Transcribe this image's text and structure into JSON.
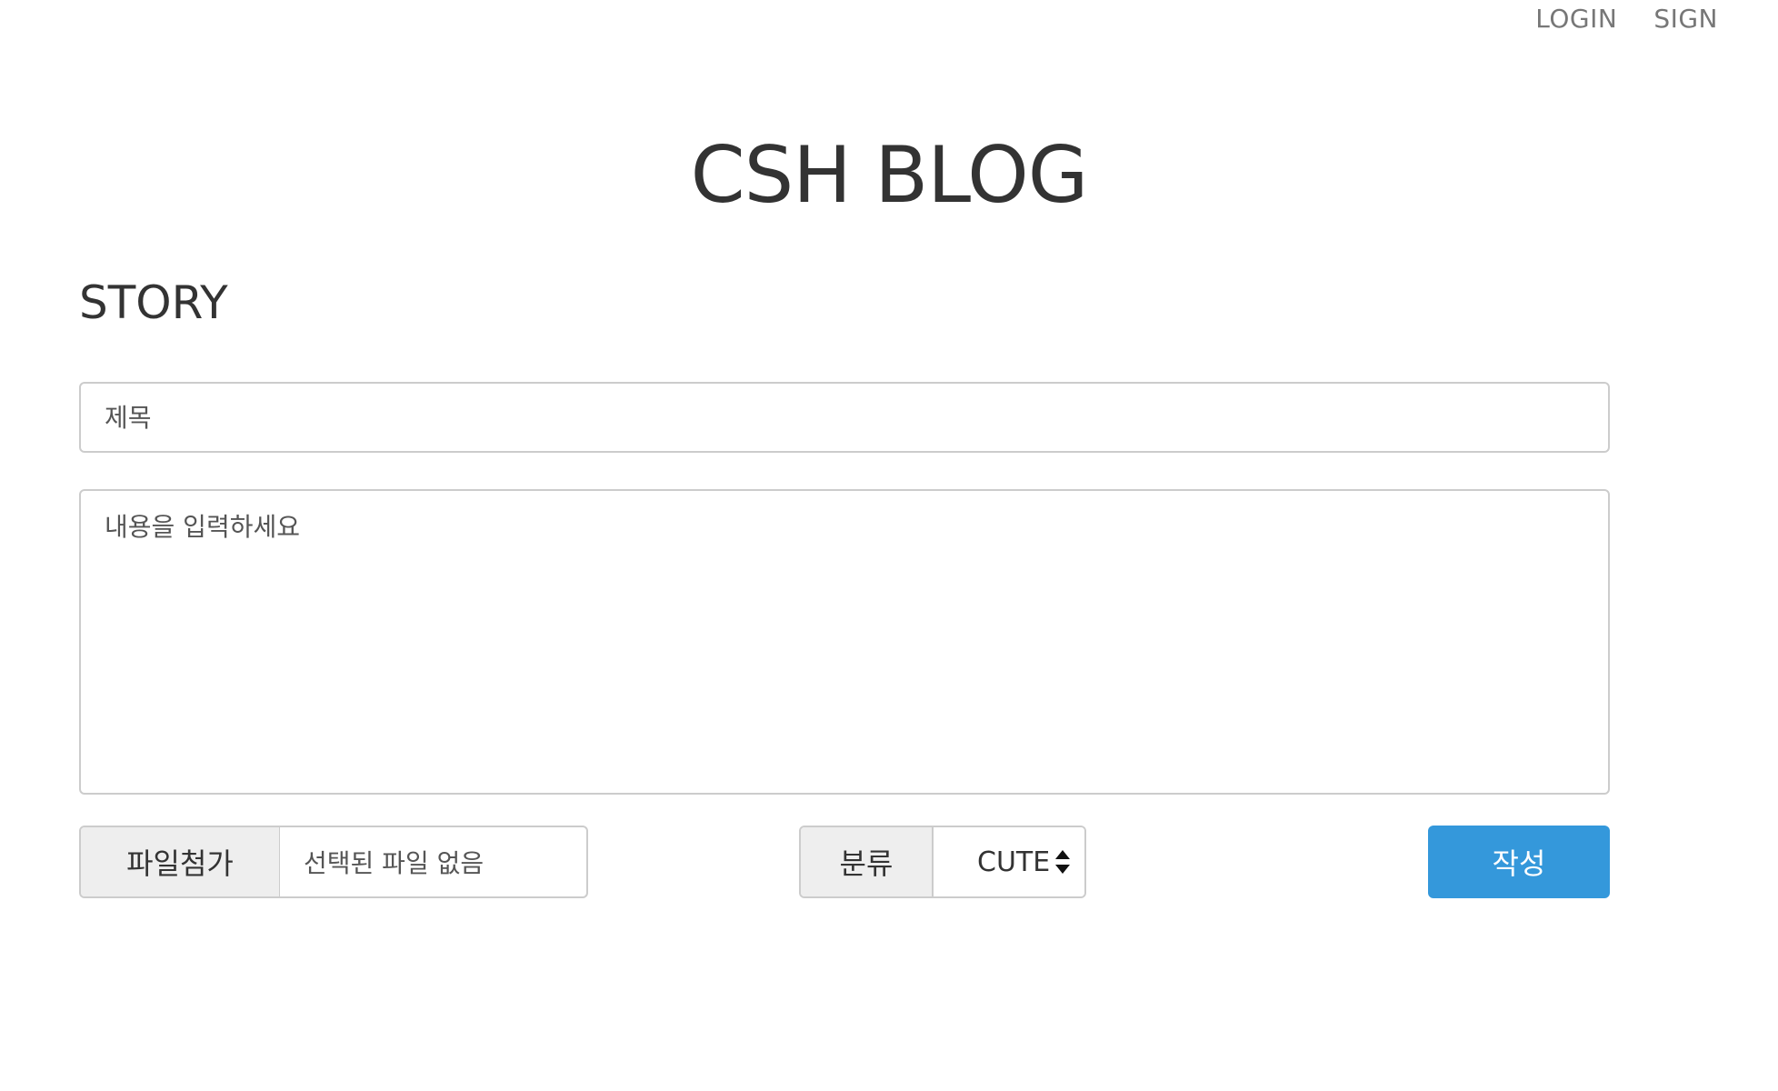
{
  "nav": {
    "login": "LOGIN",
    "sign": "SIGN"
  },
  "header": {
    "title": "CSH BLOG"
  },
  "section": {
    "title": "STORY"
  },
  "form": {
    "title_placeholder": "제목",
    "content_placeholder": "내용을 입력하세요",
    "file_button_label": "파일첨가",
    "file_status": "선택된 파일 없음",
    "category_label": "분류",
    "category_selected": "CUTE",
    "submit_label": "작성"
  },
  "colors": {
    "accent": "#3498db",
    "addon_bg": "#eeeeee",
    "border": "#cccccc"
  }
}
